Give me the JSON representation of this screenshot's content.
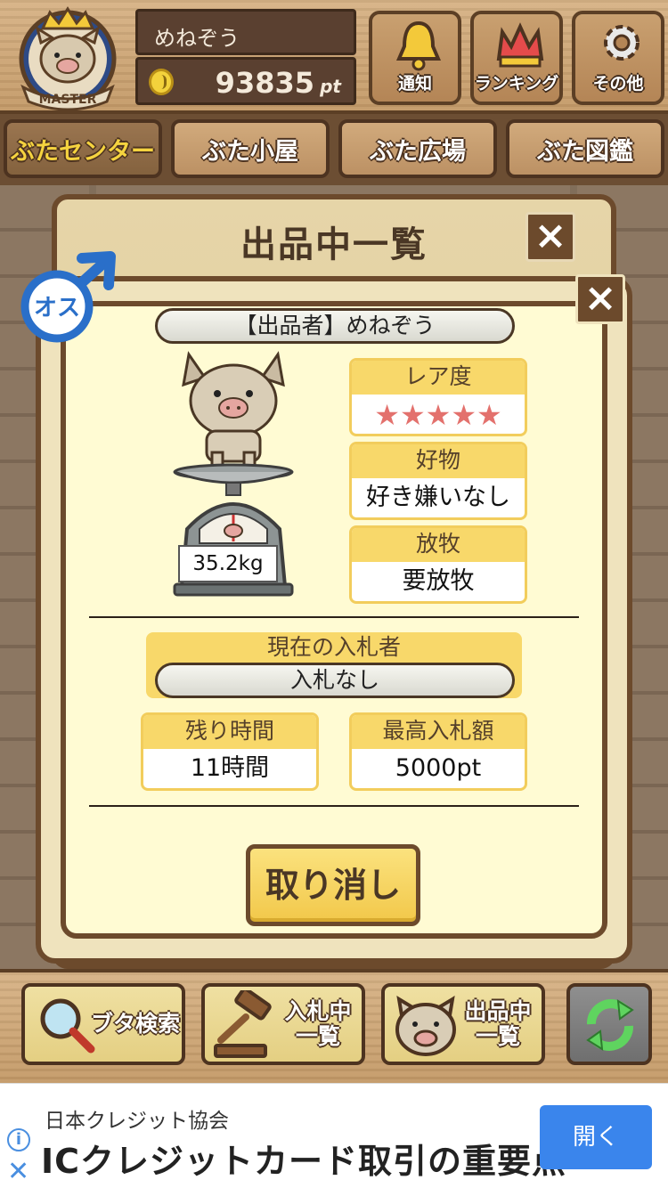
{
  "header": {
    "player_name": "めねぞう",
    "points": "93835",
    "points_unit": "pt",
    "badge_text": "MASTER",
    "buttons": [
      {
        "label": "通知",
        "icon": "bell-icon"
      },
      {
        "label": "ランキング",
        "icon": "crown-icon"
      },
      {
        "label": "その他",
        "icon": "gear-icon"
      }
    ]
  },
  "tabs": [
    {
      "label": "ぶたセンター",
      "active": true
    },
    {
      "label": "ぶた小屋",
      "active": false
    },
    {
      "label": "ぶた広場",
      "active": false
    },
    {
      "label": "ぶた図鑑",
      "active": false
    }
  ],
  "back_panel": {
    "title": "出品中一覧",
    "close": "×"
  },
  "listing": {
    "close": "×",
    "gender_badge": "オス",
    "seller": "【出品者】めねぞう",
    "weight": "35.2kg",
    "rarity_label": "レア度",
    "rarity_stars": "★★★★★",
    "rarity_value": 5,
    "favorite_label": "好物",
    "favorite_value": "好き嫌いなし",
    "grazing_label": "放牧",
    "grazing_value": "要放牧",
    "bidder_label": "現在の入札者",
    "bidder_value": "入札なし",
    "time_label": "残り時間",
    "time_value": "11時間",
    "max_bid_label": "最高入札額",
    "max_bid_value": "5000pt",
    "cancel_button": "取り消し"
  },
  "toolbar": {
    "search": "ブタ検索",
    "bidding_line1": "入札中",
    "bidding_line2": "一覧",
    "listing_line1": "出品中",
    "listing_line2": "一覧"
  },
  "ad": {
    "sponsor": "日本クレジット協会",
    "headline": "ICクレジットカード取引の重要点",
    "button": "開く"
  }
}
